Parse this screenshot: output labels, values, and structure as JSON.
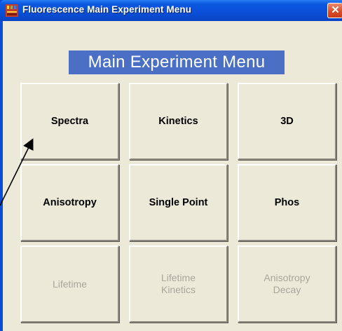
{
  "window": {
    "title": "Fluorescence Main Experiment Menu",
    "close_symbol": "✕"
  },
  "header": {
    "title": "Main Experiment Menu"
  },
  "buttons": [
    {
      "label": "Spectra",
      "enabled": true
    },
    {
      "label": "Kinetics",
      "enabled": true
    },
    {
      "label": "3D",
      "enabled": true
    },
    {
      "label": "Anisotropy",
      "enabled": true
    },
    {
      "label": "Single Point",
      "enabled": true
    },
    {
      "label": "Phos",
      "enabled": true
    },
    {
      "label": "Lifetime",
      "enabled": false
    },
    {
      "label": "Lifetime",
      "label2": "Kinetics",
      "enabled": false
    },
    {
      "label": "Anisotropy",
      "label2": "Decay",
      "enabled": false
    }
  ],
  "icons": {
    "app": "fluorescence-app-icon",
    "close": "close-icon"
  },
  "colors": {
    "titlebar": "#0a4fd7",
    "client_bg": "#ece9d8",
    "header_bg": "#4a6fc4",
    "header_text": "#ffffff",
    "disabled_text": "#a8a69c",
    "close_button": "#d94a24"
  }
}
